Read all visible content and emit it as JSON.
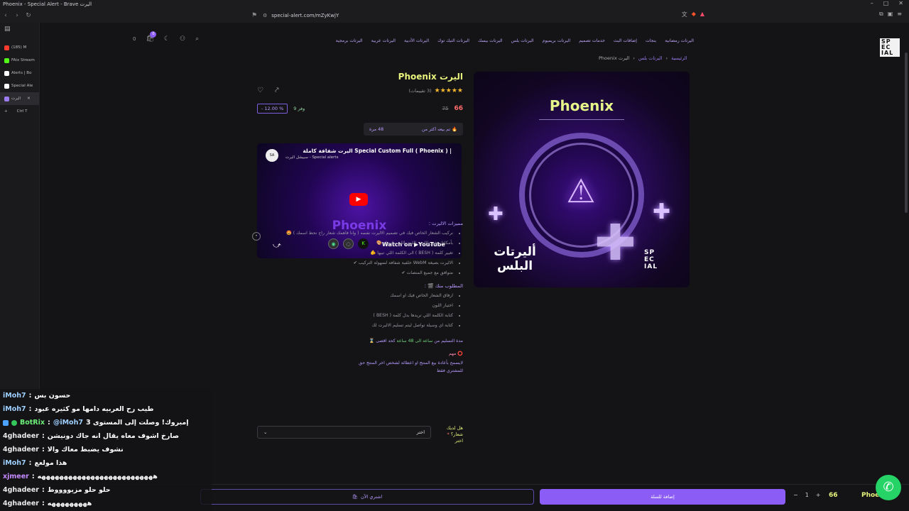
{
  "window": {
    "title": "Phoenix - Special Alert - Brave اليرت"
  },
  "browser": {
    "url": "special-alert.com/mZyKwjY",
    "tabs": [
      {
        "label": "(185) M",
        "color": "#ff3b30"
      },
      {
        "label": "FAix Stream",
        "color": "#53fc18"
      },
      {
        "label": "Alerts | Bo",
        "color": "#ffffff"
      },
      {
        "label": "Special Ale",
        "color": "#ffffff"
      },
      {
        "label": "اليرت",
        "color": "#9a7cf0"
      }
    ],
    "new_tab_label": "Ctrl T",
    "toolbar_icons": [
      "back-icon",
      "forward-icon",
      "reload-icon",
      "bookmark-icon"
    ]
  },
  "site": {
    "nav": {
      "items": [
        "اليرتات رمضانية",
        "بنجات",
        "إضافات البث",
        "خدمات تصميم",
        "اليرتات بريميوم",
        "اليرتات بلس",
        "اليرتات بيسك",
        "اليرتات التيك توك",
        "اليرتات الأدبية",
        "اليرتات عربية",
        "اليرتات برمجية"
      ],
      "cart_count": "0",
      "cart_badge": "0",
      "logo": [
        "SP",
        "EC",
        "IAL"
      ]
    },
    "breadcrumb": {
      "home": "الرئيسية",
      "category": "اليرتات بلس",
      "current": "اليرت Phoenix"
    },
    "hero": {
      "title": "Phoenix",
      "label_ar": "أليرتات البلس",
      "logo": [
        "SP",
        "EC",
        "IAL"
      ]
    },
    "product": {
      "title": "اليرت Phoenix",
      "rating_text": "(3 تقييمات)",
      "rating_value": 5,
      "price": "66",
      "old_price": "75",
      "save_text": "وفر 9",
      "discount": "- 12.00 %",
      "sold_text": "تم بيعه اكثر من",
      "sold_count": "48 مرة"
    },
    "video": {
      "title": "| Special Custom Full ( Phoenix ) اليرت شفافة كاملة",
      "channel": "Special alerts - سبيشل اليرت",
      "overlay": "Phoenix",
      "watch_on": "Watch on",
      "brand": "YouTube"
    },
    "description": {
      "features_heading": "مميزات الاليرت :",
      "features": [
        "نركيب الشعار الخاص فيك في تصميم الاليرت نفسه ( وانا فاهمك شعار راح نحط اسمك ) 🤩",
        "بأمكانك تغيير اللون باللون اللي يناسبك 🎨",
        "تغيير كلمة ( BESH ) الى الكلمة اللي تبيها 🫵",
        "الاليرت بصيغة WebM خلفية شفافة لسهولة التركيب ✔",
        "متوافق مع جميع المنصات ✔"
      ],
      "required_heading": "المطلوب منك 🎬 :",
      "required": [
        "ارفاق الشعار الخاص فيك او اسمك",
        "اختيار اللون",
        "كتابة الكلمة اللي تريدها بدل كلمة ( BESH )",
        "كتابة اي وسيلة تواصل ليتم تسليم الاليرت لك"
      ],
      "delivery_prefix": "مدة التسليم من",
      "delivery_range": "ساعة الى 48 ساعة",
      "delivery_suffix": "كحد اقصى ⌛",
      "important_heading": "⭕ مهم",
      "important_text": "لايسمح بأعادة بيع المنتج او اعطائة لشخص اخر المنتج حق للمشتري فقط"
    },
    "option": {
      "label": "هل لديك شعار؟",
      "required_mark": "*",
      "sub": "اختر",
      "value": "اختر"
    },
    "bottom": {
      "buy_now": "اشتري الآن",
      "add_to_cart": "إضافة للسلة",
      "qty": "1",
      "price": "66",
      "name": "Phoenix"
    }
  },
  "chat": [
    {
      "user": "iMoh7",
      "msg": "حسون بس",
      "color": "#9fd0ff"
    },
    {
      "user": "iMoh7",
      "msg": "طيب رح العربيه دامها مو كثيره عبود",
      "color": "#9fd0ff"
    },
    {
      "user": "BotRix",
      "msg": "إمبروك! وصلت إلى المستوى 3",
      "mention": "@iMoh7",
      "color": "#6df07a"
    },
    {
      "user": "4ghadeer",
      "msg": "صارخ اشوف معاه يقال انه جاك دونيشن",
      "color": "#e9e9e9"
    },
    {
      "user": "4ghadeer",
      "msg": "نشوف يضبط معاك والا",
      "color": "#e9e9e9"
    },
    {
      "user": "iMoh7",
      "msg": "هذا مولعع",
      "color": "#9fd0ff"
    },
    {
      "user": "xjmeer",
      "msg": "ههههههههههههههههههههههههههه",
      "color": "#c58bff"
    },
    {
      "user": "4ghadeer",
      "msg": "حلو حلو مزيووووط",
      "color": "#e9e9e9"
    },
    {
      "user": "4ghadeer",
      "msg": "هههههههههه",
      "color": "#e9e9e9"
    }
  ],
  "colors": {
    "accent": "#8b5cf6",
    "title": "#e7f37c",
    "price": "#ff6b6b",
    "whatsapp": "#25d366"
  }
}
